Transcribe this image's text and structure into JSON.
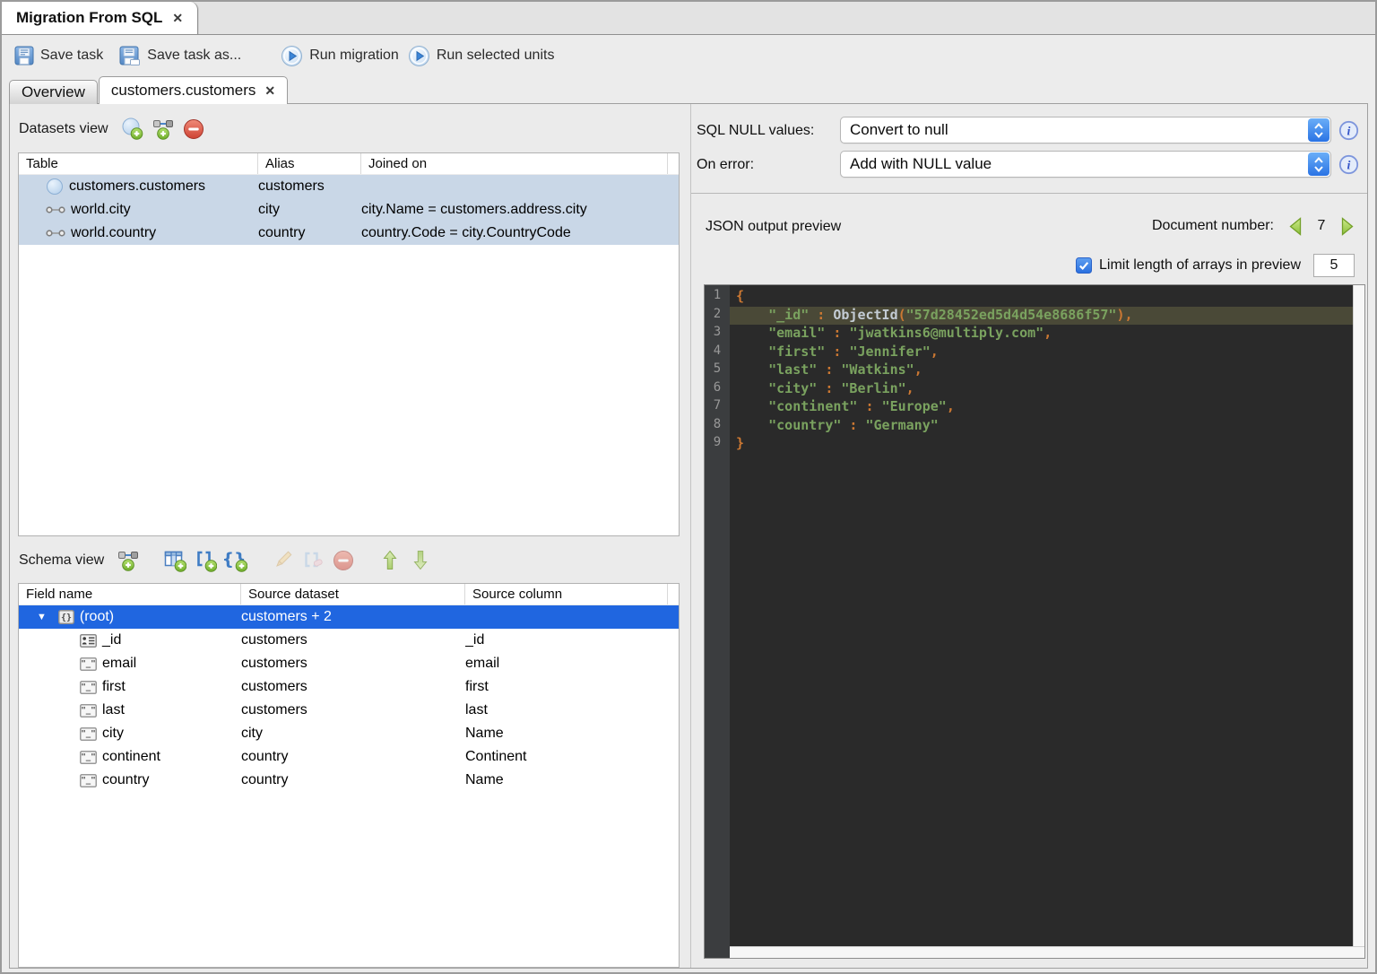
{
  "main_tab": {
    "title": "Migration From SQL",
    "close_icon": "✕"
  },
  "toolbar": {
    "save_label": "Save task",
    "save_as_label": "Save task as...",
    "run_label": "Run migration",
    "run_selected_label": "Run selected units"
  },
  "subtabs": {
    "overview_label": "Overview",
    "active_label": "customers.customers",
    "close_icon": "✕"
  },
  "datasets_view": {
    "title": "Datasets view",
    "columns": {
      "table": "Table",
      "alias": "Alias",
      "joined_on": "Joined on"
    },
    "rows": [
      {
        "icon": "collection",
        "table": "customers.customers",
        "alias": "customers",
        "joined_on": ""
      },
      {
        "icon": "join",
        "table": "world.city",
        "alias": "city",
        "joined_on": "city.Name = customers.address.city"
      },
      {
        "icon": "join",
        "table": "world.country",
        "alias": "country",
        "joined_on": "country.Code = city.CountryCode"
      }
    ]
  },
  "schema_view": {
    "title": "Schema view",
    "columns": {
      "field": "Field name",
      "dataset": "Source dataset",
      "column": "Source column"
    },
    "root_row": {
      "field": "(root)",
      "dataset": "customers + 2",
      "column": ""
    },
    "rows": [
      {
        "icon": "id",
        "field": "_id",
        "dataset": "customers",
        "column": "_id"
      },
      {
        "icon": "string",
        "field": "email",
        "dataset": "customers",
        "column": "email"
      },
      {
        "icon": "string",
        "field": "first",
        "dataset": "customers",
        "column": "first"
      },
      {
        "icon": "string",
        "field": "last",
        "dataset": "customers",
        "column": "last"
      },
      {
        "icon": "string",
        "field": "city",
        "dataset": "city",
        "column": "Name"
      },
      {
        "icon": "string",
        "field": "continent",
        "dataset": "country",
        "column": "Continent"
      },
      {
        "icon": "string",
        "field": "country",
        "dataset": "country",
        "column": "Name"
      }
    ]
  },
  "options": {
    "sql_null_label": "SQL NULL values:",
    "sql_null_value": "Convert to null",
    "on_error_label": "On error:",
    "on_error_value": "Add with NULL value"
  },
  "preview": {
    "title": "JSON output preview",
    "document_number_label": "Document number:",
    "document_number": "7",
    "limit_label": "Limit length of arrays in preview",
    "limit_value": "5",
    "limit_checked": true
  },
  "editor": {
    "lines": [
      {
        "n": "1",
        "hl": false,
        "tokens": [
          [
            "p",
            "{"
          ]
        ]
      },
      {
        "n": "2",
        "hl": true,
        "tokens": [
          [
            "w",
            "    "
          ],
          [
            "k",
            "\"_id\""
          ],
          [
            "p",
            " : "
          ],
          [
            "f",
            "ObjectId"
          ],
          [
            "p",
            "("
          ],
          [
            "s",
            "\"57d28452ed5d4d54e8686f57\""
          ],
          [
            "p",
            "),"
          ]
        ]
      },
      {
        "n": "3",
        "hl": false,
        "tokens": [
          [
            "w",
            "    "
          ],
          [
            "k",
            "\"email\""
          ],
          [
            "p",
            " : "
          ],
          [
            "s",
            "\"jwatkins6@multiply.com\""
          ],
          [
            "p",
            ","
          ]
        ]
      },
      {
        "n": "4",
        "hl": false,
        "tokens": [
          [
            "w",
            "    "
          ],
          [
            "k",
            "\"first\""
          ],
          [
            "p",
            " : "
          ],
          [
            "s",
            "\"Jennifer\""
          ],
          [
            "p",
            ","
          ]
        ]
      },
      {
        "n": "5",
        "hl": false,
        "tokens": [
          [
            "w",
            "    "
          ],
          [
            "k",
            "\"last\""
          ],
          [
            "p",
            " : "
          ],
          [
            "s",
            "\"Watkins\""
          ],
          [
            "p",
            ","
          ]
        ]
      },
      {
        "n": "6",
        "hl": false,
        "tokens": [
          [
            "w",
            "    "
          ],
          [
            "k",
            "\"city\""
          ],
          [
            "p",
            " : "
          ],
          [
            "s",
            "\"Berlin\""
          ],
          [
            "p",
            ","
          ]
        ]
      },
      {
        "n": "7",
        "hl": false,
        "tokens": [
          [
            "w",
            "    "
          ],
          [
            "k",
            "\"continent\""
          ],
          [
            "p",
            " : "
          ],
          [
            "s",
            "\"Europe\""
          ],
          [
            "p",
            ","
          ]
        ]
      },
      {
        "n": "8",
        "hl": false,
        "tokens": [
          [
            "w",
            "    "
          ],
          [
            "k",
            "\"country\""
          ],
          [
            "p",
            " : "
          ],
          [
            "s",
            "\"Germany\""
          ]
        ]
      },
      {
        "n": "9",
        "hl": false,
        "tokens": [
          [
            "p",
            "}"
          ]
        ]
      }
    ]
  },
  "colors": {
    "selection_focused": "#2066e0",
    "selection_unfocused": "#c9d7e7",
    "editor_bg": "#2a2a2a",
    "editor_gutter_bg": "#3b3d3f",
    "editor_line_highlight": "#4a4937",
    "token_green": "#7aa25f",
    "token_orange": "#cc7832",
    "token_function": "#c3ccd4",
    "accent_blue": "#2a73e4"
  }
}
